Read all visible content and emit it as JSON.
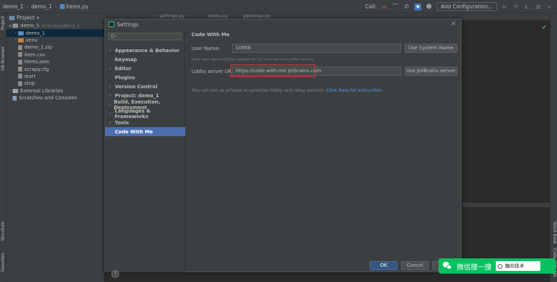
{
  "breadcrumb": [
    "demo_1",
    "demo_1",
    "items.py"
  ],
  "toolbar": {
    "call_label": "Call:",
    "add_configuration": "Add Configuration..."
  },
  "project_panel": {
    "title": "Project",
    "tree": [
      {
        "label": "demo_1",
        "extra": "E:\\scrapy\\demo_1",
        "type": "folder",
        "expanded": true
      },
      {
        "label": "demo_1",
        "type": "folder-blue",
        "selected": true
      },
      {
        "label": "venv",
        "type": "folder-orange"
      },
      {
        "label": "demo_1.zip",
        "type": "file"
      },
      {
        "label": "item.csv",
        "type": "file"
      },
      {
        "label": "items.json",
        "type": "file"
      },
      {
        "label": "scrapy.cfg",
        "type": "file"
      },
      {
        "label": "start",
        "type": "file"
      },
      {
        "label": "stop",
        "type": "file"
      },
      {
        "label": "External Libraries",
        "type": "lib"
      },
      {
        "label": "Scratches and Consoles",
        "type": "scratch"
      }
    ]
  },
  "side_tabs": {
    "project": "Project",
    "db_browser": "DB Browser",
    "structure": "Structure",
    "favorites": "Favorites",
    "word_book": "Word Book",
    "code_with_me": "Code With Me"
  },
  "editor_tabs": [
    "settings.py",
    "items.py",
    "pipelines.py"
  ],
  "dialog": {
    "title": "Settings",
    "search_placeholder": "Q-",
    "nav": [
      {
        "label": "Appearance & Behavior",
        "arrow": true
      },
      {
        "label": "Keymap",
        "arrow": false
      },
      {
        "label": "Editor",
        "arrow": true
      },
      {
        "label": "Plugins",
        "arrow": false
      },
      {
        "label": "Version Control",
        "arrow": true
      },
      {
        "label": "Project: demo_1",
        "arrow": true
      },
      {
        "label": "Build, Execution, Deployment",
        "arrow": true
      },
      {
        "label": "Languages & Frameworks",
        "arrow": true
      },
      {
        "label": "Tools",
        "arrow": true
      },
      {
        "label": "Code With Me",
        "arrow": false,
        "selected": true
      }
    ],
    "section_title": "Code With Me",
    "user_name_label": "User Name:",
    "user_name_value": "10956",
    "use_system_name": "Use System Name",
    "hint": "New user name will be applied for all new sessions after restart",
    "lobby_label": "Lobby server URL:",
    "lobby_value": "https://code-with-me.jetbrains.com",
    "use_jetbrains_server": "Use JetBrains server",
    "info_text": "You can set up private on-premise lobby and relay servers.",
    "info_link": "Click here for instruction.",
    "help": "?",
    "ok": "OK",
    "cancel": "Cancel"
  },
  "watermark": {
    "text": "微信搜一搜",
    "search_text": "偏向技术"
  }
}
